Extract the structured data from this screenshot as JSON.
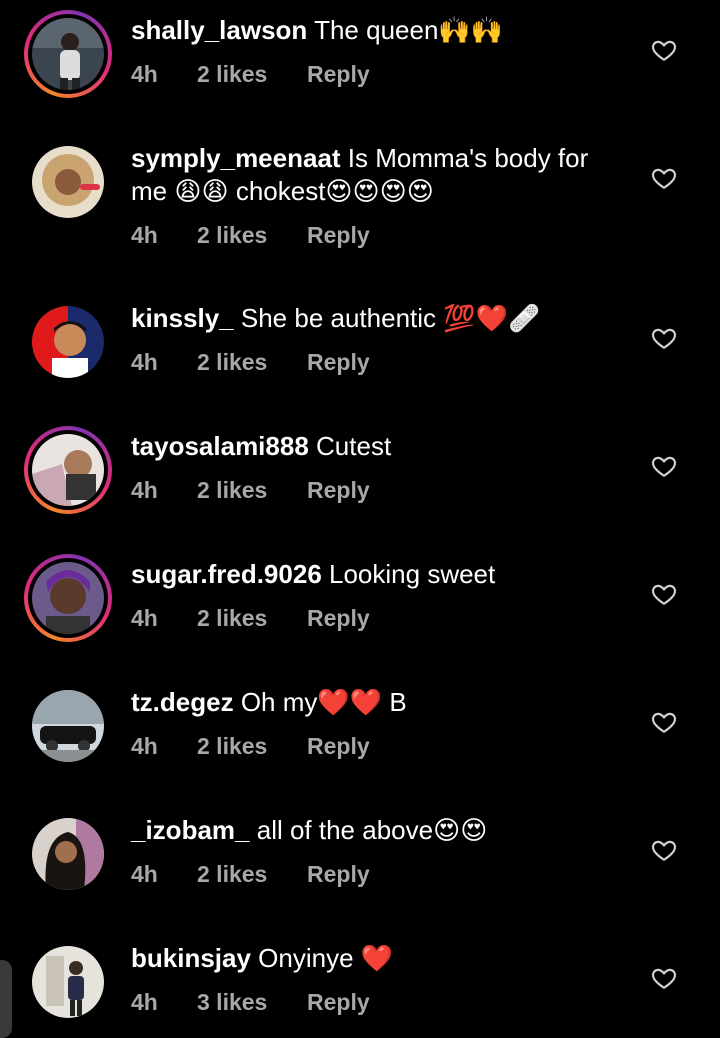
{
  "colors": {
    "background": "#000000",
    "text": "#ffffff",
    "meta": "#a8a8a8",
    "heart_emoji": "#e0245e"
  },
  "comments": [
    {
      "username": "shally_lawson",
      "text": "The queen",
      "emoji": "🙌🙌",
      "time": "4h",
      "likes": "2 likes",
      "reply": "Reply",
      "story_ring": true,
      "avatar_icon": "avatar-photo-man"
    },
    {
      "username": "symply_meenaat",
      "text": "Is Momma's body for me",
      "emoji": "😩😩",
      "text2": "chokest",
      "emoji2": "😍😍😍😍",
      "time": "4h",
      "likes": "2 likes",
      "reply": "Reply",
      "story_ring": false,
      "avatar_icon": "avatar-photo-woman"
    },
    {
      "username": "kinssly_",
      "text": "She be authentic",
      "emoji": "💯❤️🩹",
      "time": "4h",
      "likes": "2 likes",
      "reply": "Reply",
      "story_ring": false,
      "avatar_icon": "avatar-cartoon"
    },
    {
      "username": "tayosalami888",
      "text": "Cutest",
      "emoji": "",
      "time": "4h",
      "likes": "2 likes",
      "reply": "Reply",
      "story_ring": true,
      "avatar_icon": "avatar-photo-hand"
    },
    {
      "username": "sugar.fred.9026",
      "text": "Looking sweet",
      "emoji": "",
      "time": "4h",
      "likes": "2 likes",
      "reply": "Reply",
      "story_ring": true,
      "avatar_icon": "avatar-photo-woman-purple"
    },
    {
      "username": "tz.degez",
      "text": "Oh my",
      "emoji": "❤️❤️",
      "text2": "B",
      "time": "4h",
      "likes": "2 likes",
      "reply": "Reply",
      "story_ring": false,
      "avatar_icon": "avatar-photo-car"
    },
    {
      "username": "_izobam_",
      "text": "all of the above",
      "emoji": "😍😍",
      "time": "4h",
      "likes": "2 likes",
      "reply": "Reply",
      "story_ring": false,
      "avatar_icon": "avatar-photo-woman-hair"
    },
    {
      "username": "bukinsjay",
      "text": "Onyinye",
      "emoji": "❤️",
      "time": "4h",
      "likes": "3 likes",
      "reply": "Reply",
      "story_ring": false,
      "avatar_icon": "avatar-photo-man-standing"
    }
  ]
}
